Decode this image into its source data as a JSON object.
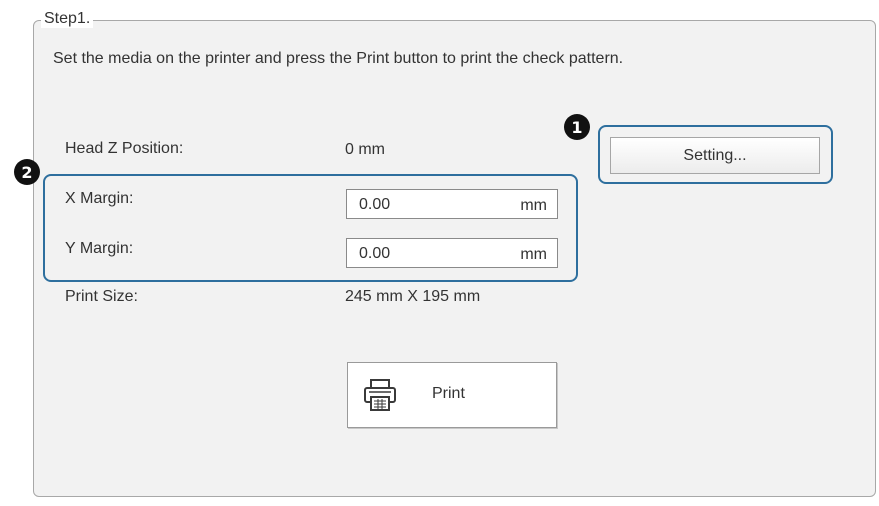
{
  "group": {
    "legend": "Step1."
  },
  "instruction": "Set the media on the printer and press the Print button to print the check pattern.",
  "head_z": {
    "label": "Head Z Position:",
    "value": "0 mm"
  },
  "x_margin": {
    "label": "X Margin:",
    "value": "0.00",
    "unit": "mm"
  },
  "y_margin": {
    "label": "Y Margin:",
    "value": "0.00",
    "unit": "mm"
  },
  "print_size": {
    "label": "Print Size:",
    "value": "245 mm X 195 mm"
  },
  "buttons": {
    "setting": "Setting...",
    "print": "Print"
  },
  "callouts": {
    "one": "1",
    "two": "2"
  },
  "icons": {
    "print": "printer-icon"
  },
  "colors": {
    "highlight": "#2e6f9e",
    "panel_bg": "#f2f2f2",
    "callout_bg": "#111111"
  }
}
